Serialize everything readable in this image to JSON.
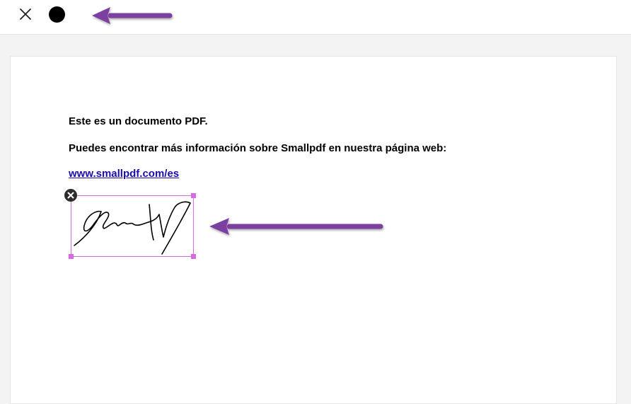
{
  "toolbar": {
    "close_icon": "close-icon",
    "color_swatch": {
      "icon": "color-dot-icon",
      "color": "#000000"
    }
  },
  "document": {
    "line1": "Este es un documento PDF.",
    "line2": "Puedes encontrar más información sobre Smallpdf en nuestra página web:",
    "link": "www.smallpdf.com/es"
  },
  "signature": {
    "delete_icon": "delete-icon",
    "border_color": "#d76ae0"
  },
  "annotations": {
    "arrow_color": "#7b3fa0"
  }
}
